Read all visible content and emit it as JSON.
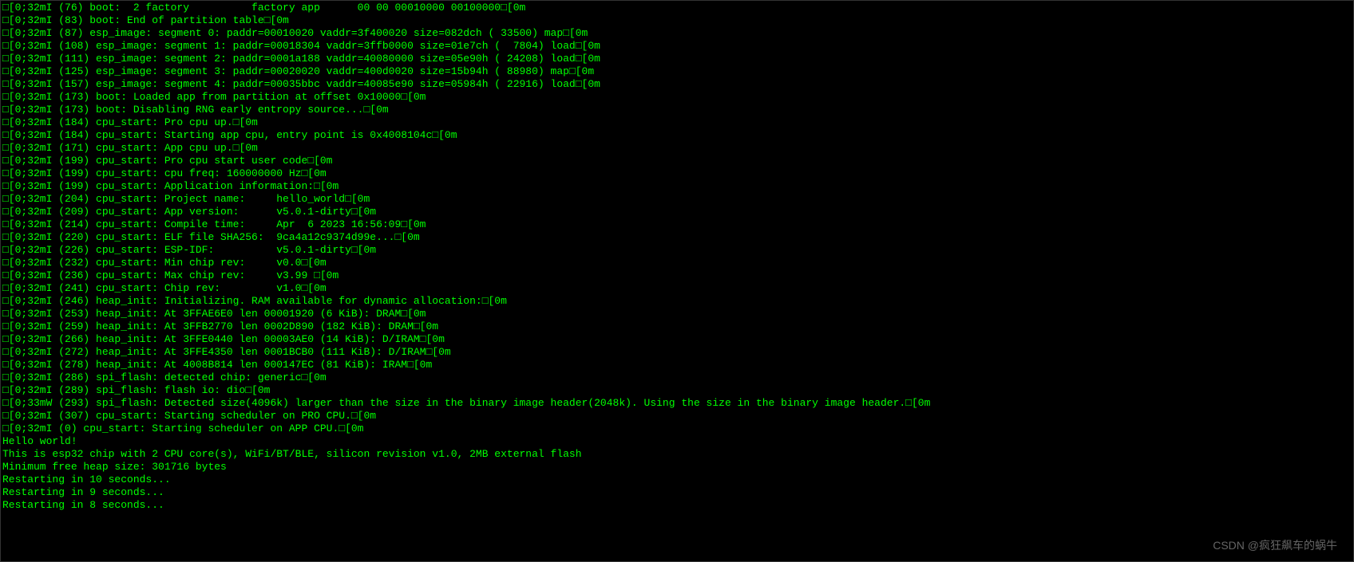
{
  "terminal": {
    "lines": [
      "□[0;32mI (76) boot:  2 factory          factory app      00 00 00010000 00100000□[0m",
      "□[0;32mI (83) boot: End of partition table□[0m",
      "□[0;32mI (87) esp_image: segment 0: paddr=00010020 vaddr=3f400020 size=082dch ( 33500) map□[0m",
      "□[0;32mI (108) esp_image: segment 1: paddr=00018304 vaddr=3ffb0000 size=01e7ch (  7804) load□[0m",
      "□[0;32mI (111) esp_image: segment 2: paddr=0001a188 vaddr=40080000 size=05e90h ( 24208) load□[0m",
      "□[0;32mI (125) esp_image: segment 3: paddr=00020020 vaddr=400d0020 size=15b94h ( 88980) map□[0m",
      "□[0;32mI (157) esp_image: segment 4: paddr=00035bbc vaddr=40085e90 size=05984h ( 22916) load□[0m",
      "□[0;32mI (173) boot: Loaded app from partition at offset 0x10000□[0m",
      "□[0;32mI (173) boot: Disabling RNG early entropy source...□[0m",
      "□[0;32mI (184) cpu_start: Pro cpu up.□[0m",
      "□[0;32mI (184) cpu_start: Starting app cpu, entry point is 0x4008104c□[0m",
      "□[0;32mI (171) cpu_start: App cpu up.□[0m",
      "□[0;32mI (199) cpu_start: Pro cpu start user code□[0m",
      "□[0;32mI (199) cpu_start: cpu freq: 160000000 Hz□[0m",
      "□[0;32mI (199) cpu_start: Application information:□[0m",
      "□[0;32mI (204) cpu_start: Project name:     hello_world□[0m",
      "□[0;32mI (209) cpu_start: App version:      v5.0.1-dirty□[0m",
      "□[0;32mI (214) cpu_start: Compile time:     Apr  6 2023 16:56:09□[0m",
      "□[0;32mI (220) cpu_start: ELF file SHA256:  9ca4a12c9374d99e...□[0m",
      "□[0;32mI (226) cpu_start: ESP-IDF:          v5.0.1-dirty□[0m",
      "□[0;32mI (232) cpu_start: Min chip rev:     v0.0□[0m",
      "□[0;32mI (236) cpu_start: Max chip rev:     v3.99 □[0m",
      "□[0;32mI (241) cpu_start: Chip rev:         v1.0□[0m",
      "□[0;32mI (246) heap_init: Initializing. RAM available for dynamic allocation:□[0m",
      "□[0;32mI (253) heap_init: At 3FFAE6E0 len 00001920 (6 KiB): DRAM□[0m",
      "□[0;32mI (259) heap_init: At 3FFB2770 len 0002D890 (182 KiB): DRAM□[0m",
      "□[0;32mI (266) heap_init: At 3FFE0440 len 00003AE0 (14 KiB): D/IRAM□[0m",
      "□[0;32mI (272) heap_init: At 3FFE4350 len 0001BCB0 (111 KiB): D/IRAM□[0m",
      "□[0;32mI (278) heap_init: At 4008B814 len 000147EC (81 KiB): IRAM□[0m",
      "□[0;32mI (286) spi_flash: detected chip: generic□[0m",
      "□[0;32mI (289) spi_flash: flash io: dio□[0m",
      "□[0;33mW (293) spi_flash: Detected size(4096k) larger than the size in the binary image header(2048k). Using the size in the binary image header.□[0m",
      "□[0;32mI (307) cpu_start: Starting scheduler on PRO CPU.□[0m",
      "□[0;32mI (0) cpu_start: Starting scheduler on APP CPU.□[0m",
      "Hello world!",
      "This is esp32 chip with 2 CPU core(s), WiFi/BT/BLE, silicon revision v1.0, 2MB external flash",
      "Minimum free heap size: 301716 bytes",
      "Restarting in 10 seconds...",
      "Restarting in 9 seconds...",
      "Restarting in 8 seconds..."
    ]
  },
  "watermark": "CSDN @疯狂飙车的蜗牛"
}
